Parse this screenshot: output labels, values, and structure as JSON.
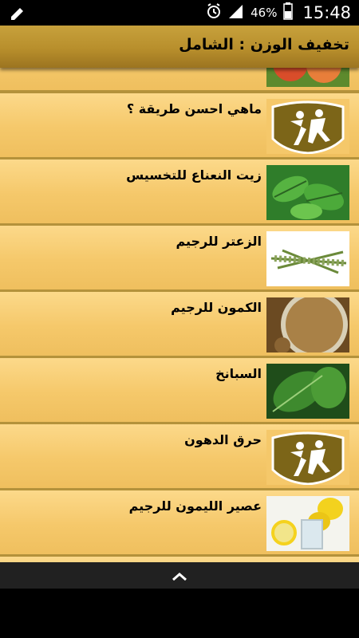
{
  "status_bar": {
    "battery_percent": "46%",
    "time": "15:48",
    "icons": [
      "edit-icon",
      "alarm-icon",
      "signal-icon",
      "battery-icon"
    ]
  },
  "app_bar": {
    "title": "تخفيف الوزن : الشامل"
  },
  "list": {
    "items": [
      {
        "label": "",
        "image": "peaches-image"
      },
      {
        "label": "ماهي احسن طريقة ؟",
        "image": "badge-logo-image"
      },
      {
        "label": "زيت النعناع  للتخسيس",
        "image": "mint-leaves-image"
      },
      {
        "label": "الزعتر للرجيم",
        "image": "thyme-image"
      },
      {
        "label": "الكمون للرجيم",
        "image": "cumin-image"
      },
      {
        "label": "السبانخ",
        "image": "spinach-image"
      },
      {
        "label": "حرق الدهون",
        "image": "badge-logo-image"
      },
      {
        "label": "عصير الليمون للرجيم",
        "image": "lemon-juice-image"
      },
      {
        "label": "",
        "image": "partial-image"
      }
    ]
  },
  "bottom_bar": {
    "icon": "chevron-up-icon"
  },
  "colors": {
    "app_bar": "#b88f2c",
    "item_bg": "#f5c86a",
    "badge_bg": "#7c6518"
  }
}
